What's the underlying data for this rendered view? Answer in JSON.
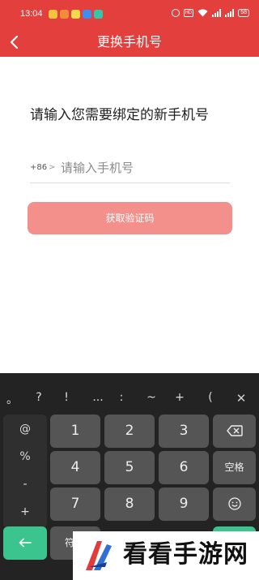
{
  "status_bar": {
    "time": "13:04",
    "battery": "58",
    "hd": "HD"
  },
  "header": {
    "title": "更换手机号",
    "back_icon": "chevron-left-icon"
  },
  "form": {
    "prompt": "请输入您需要绑定的新手机号",
    "country_code": "+86",
    "country_chevron": ">",
    "phone_placeholder": "请输入手机号",
    "phone_value": "",
    "get_code_label": "获取验证码"
  },
  "keyboard": {
    "symbols": [
      "。",
      "?",
      "!",
      "...",
      ":",
      "~",
      "+",
      "("
    ],
    "close_symbol": "✕",
    "side_keys": [
      "@",
      "%",
      "-",
      "+"
    ],
    "digits": [
      "1",
      "2",
      "3",
      "4",
      "5",
      "6",
      "7",
      "8",
      "9"
    ],
    "space_label": "空格",
    "symbol_key_label": "符"
  },
  "watermark": {
    "text": "看看手游网"
  },
  "colors": {
    "brand_red": "#e3403d",
    "button_disabled": "#f3908c",
    "keyboard_bg": "#232323",
    "key_bg": "#555555",
    "green_key": "#3cc48e"
  }
}
